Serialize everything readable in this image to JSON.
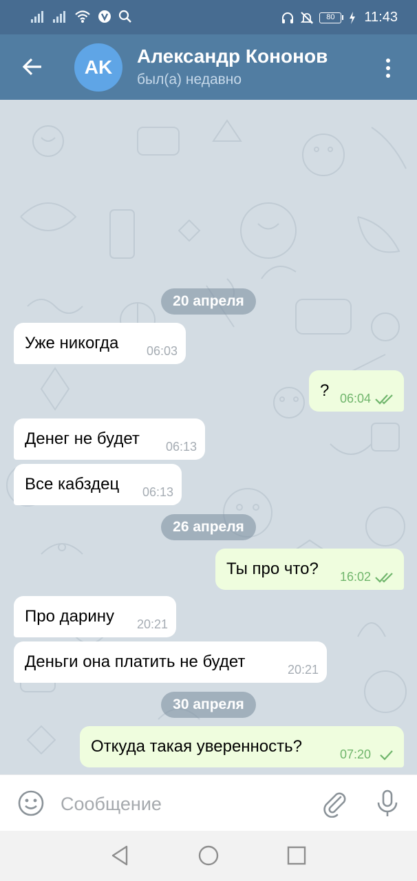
{
  "status_bar": {
    "time": "11:43",
    "battery": "80",
    "icons": [
      "signal-icon",
      "signal-icon",
      "wifi-icon",
      "vpn-icon",
      "search-icon",
      "headphones-icon",
      "bell-off-icon",
      "battery-icon",
      "charging-icon"
    ]
  },
  "header": {
    "avatar_initials": "AK",
    "name": "Александр Кононов",
    "status": "был(а) недавно",
    "colors": {
      "bar": "#517da2",
      "avatar": "#5fa5e6"
    }
  },
  "chat": {
    "dates": [
      "20 апреля",
      "26 апреля",
      "30 апреля"
    ],
    "messages": [
      {
        "dir": "in",
        "text": "Уже никогда",
        "time": "06:03"
      },
      {
        "dir": "out",
        "text": "?",
        "time": "06:04",
        "status": "read"
      },
      {
        "dir": "in",
        "text": "Денег не будет",
        "time": "06:13"
      },
      {
        "dir": "in",
        "text": "Все кабздец",
        "time": "06:13"
      },
      {
        "dir": "out",
        "text": "Ты про что?",
        "time": "16:02",
        "status": "read"
      },
      {
        "dir": "in",
        "text": "Про дарину",
        "time": "20:21"
      },
      {
        "dir": "in",
        "text": "Деньги она платить не будет",
        "time": "20:21"
      },
      {
        "dir": "out",
        "text": "Откуда такая уверенность?",
        "time": "07:20",
        "status": "sent"
      }
    ],
    "colors": {
      "incoming": "#ffffff",
      "outgoing": "#effdde",
      "check": "#6fb56b"
    }
  },
  "composer": {
    "placeholder": "Сообщение"
  }
}
